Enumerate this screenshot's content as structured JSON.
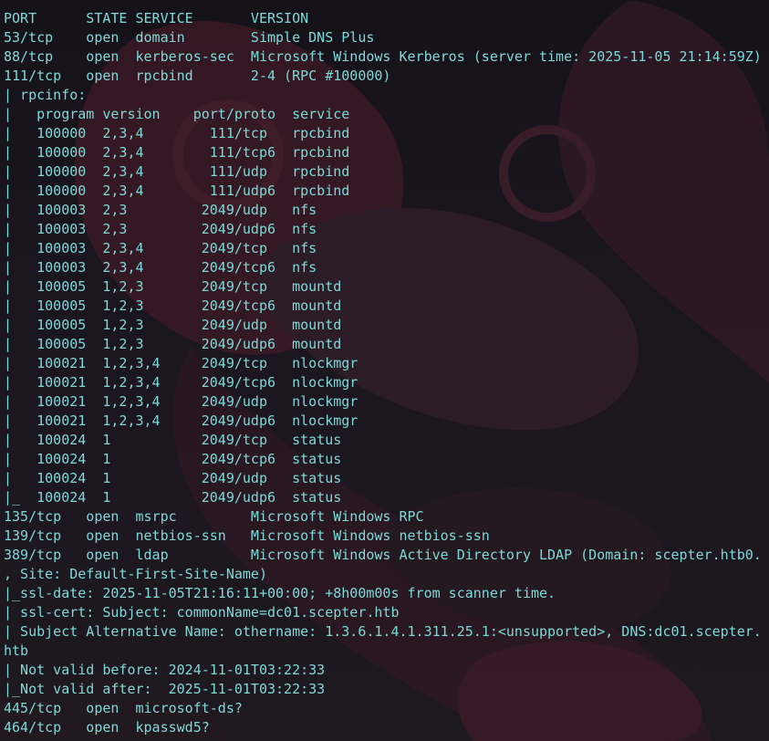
{
  "terminal": {
    "wallpaper_icon": "red-goggled-character-wallpaper",
    "text_color": "#7fd9d6",
    "background_color": "#17131b",
    "lines": [
      "PORT      STATE SERVICE       VERSION",
      "53/tcp    open  domain        Simple DNS Plus",
      "88/tcp    open  kerberos-sec  Microsoft Windows Kerberos (server time: 2025-11-05 21:14:59Z)",
      "111/tcp   open  rpcbind       2-4 (RPC #100000)",
      "| rpcinfo:",
      "|   program version    port/proto  service",
      "|   100000  2,3,4        111/tcp   rpcbind",
      "|   100000  2,3,4        111/tcp6  rpcbind",
      "|   100000  2,3,4        111/udp   rpcbind",
      "|   100000  2,3,4        111/udp6  rpcbind",
      "|   100003  2,3         2049/udp   nfs",
      "|   100003  2,3         2049/udp6  nfs",
      "|   100003  2,3,4       2049/tcp   nfs",
      "|   100003  2,3,4       2049/tcp6  nfs",
      "|   100005  1,2,3       2049/tcp   mountd",
      "|   100005  1,2,3       2049/tcp6  mountd",
      "|   100005  1,2,3       2049/udp   mountd",
      "|   100005  1,2,3       2049/udp6  mountd",
      "|   100021  1,2,3,4     2049/tcp   nlockmgr",
      "|   100021  1,2,3,4     2049/tcp6  nlockmgr",
      "|   100021  1,2,3,4     2049/udp   nlockmgr",
      "|   100021  1,2,3,4     2049/udp6  nlockmgr",
      "|   100024  1           2049/tcp   status",
      "|   100024  1           2049/tcp6  status",
      "|   100024  1           2049/udp   status",
      "|_  100024  1           2049/udp6  status",
      "135/tcp   open  msrpc         Microsoft Windows RPC",
      "139/tcp   open  netbios-ssn   Microsoft Windows netbios-ssn",
      "389/tcp   open  ldap          Microsoft Windows Active Directory LDAP (Domain: scepter.htb0.",
      ", Site: Default-First-Site-Name)",
      "|_ssl-date: 2025-11-05T21:16:11+00:00; +8h00m00s from scanner time.",
      "| ssl-cert: Subject: commonName=dc01.scepter.htb",
      "| Subject Alternative Name: othername: 1.3.6.1.4.1.311.25.1:<unsupported>, DNS:dc01.scepter.",
      "htb",
      "| Not valid before: 2024-11-01T03:22:33",
      "|_Not valid after:  2025-11-01T03:22:33",
      "445/tcp   open  microsoft-ds?",
      "464/tcp   open  kpasswd5?"
    ]
  }
}
